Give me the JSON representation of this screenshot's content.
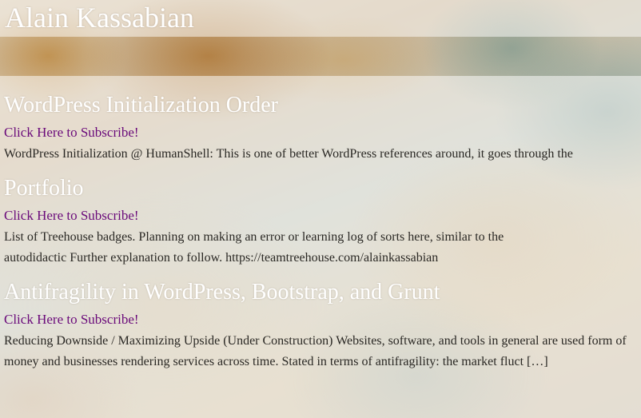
{
  "site": {
    "title": "Alain Kassabian"
  },
  "posts": [
    {
      "title": "WordPress Initialization Order",
      "subscribe": "Click Here to Subscribe!",
      "excerpt": "WordPress Initialization @ HumanShell: This is one of better WordPress references around, it goes through the"
    },
    {
      "title": "Portfolio",
      "subscribe": "Click Here to Subscribe!",
      "excerpt": "List of Treehouse badges. Planning on making an error or learning log of sorts here, similar to the autodidactic Further explanation to follow. https://teamtreehouse.com/alainkassabian"
    },
    {
      "title": "Antifragility in WordPress, Bootstrap, and Grunt",
      "subscribe": "Click Here to Subscribe!",
      "excerpt": "Reducing Downside / Maximizing Upside (Under Construction) Websites, software, and tools in general are used form of money and businesses rendering services across time. Stated in terms of antifragility: the market fluct […]"
    }
  ],
  "colors": {
    "title_text": "#ffffff",
    "subscribe_link": "#6a0a7a",
    "body_text": "#2a2824"
  }
}
